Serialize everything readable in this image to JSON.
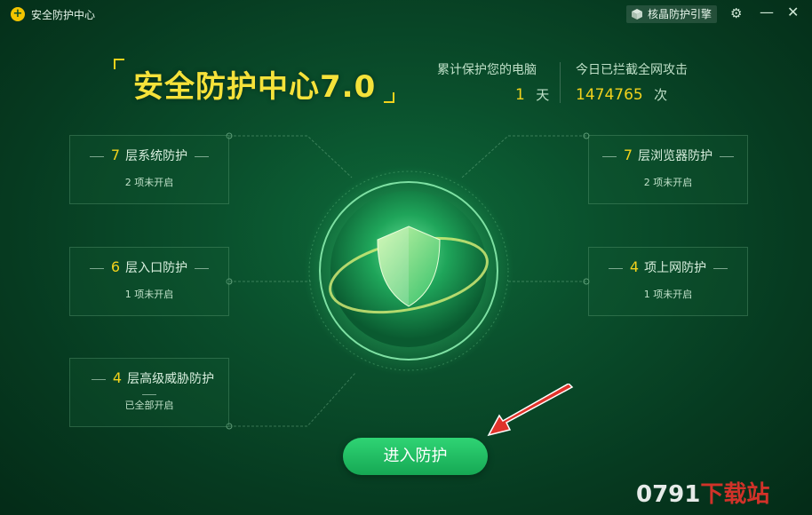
{
  "titlebar": {
    "app_title": "安全防护中心",
    "engine_label": "核晶防护引擎",
    "icons": [
      "gear-icon",
      "minimize-icon",
      "close-icon"
    ]
  },
  "header": {
    "title": "安全防护中心7.0",
    "stats": [
      {
        "label": "累计保护您的电脑",
        "value": "1",
        "unit": "天"
      },
      {
        "label": "今日已拦截全网攻击",
        "value": "1474765",
        "unit": "次"
      }
    ]
  },
  "cards": {
    "left": [
      {
        "num": "7",
        "title": "层系统防护",
        "sub": "2 项未开启"
      },
      {
        "num": "6",
        "title": "层入口防护",
        "sub": "1 项未开启"
      },
      {
        "num": "4",
        "title": "层高级威胁防护",
        "sub": "已全部开启"
      }
    ],
    "right": [
      {
        "num": "7",
        "title": "层浏览器防护",
        "sub": "2 项未开启"
      },
      {
        "num": "4",
        "title": "项上网防护",
        "sub": "1 项未开启"
      }
    ]
  },
  "main": {
    "enter_button": "进入防护"
  },
  "watermark": {
    "prefix": "0791",
    "suffix": "下载站"
  },
  "colors": {
    "accent": "#f2d21c",
    "button": "#22c064",
    "background": "#0a4f2c"
  }
}
